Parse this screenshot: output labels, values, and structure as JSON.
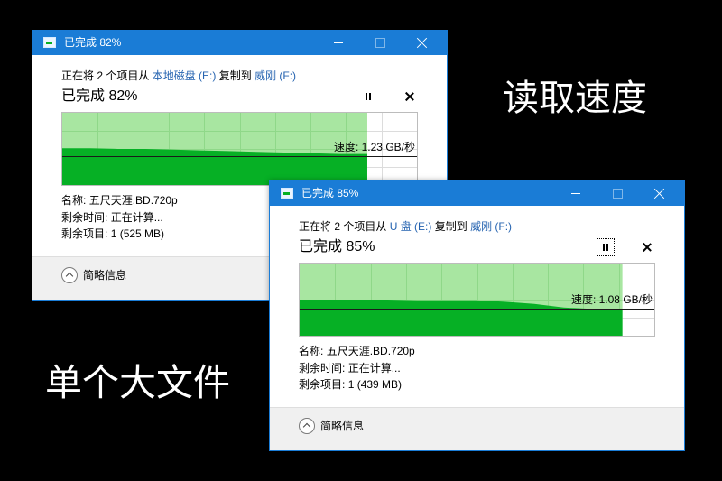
{
  "captions": {
    "top_right": "读取速度",
    "bottom_left": "单个大文件"
  },
  "colors": {
    "background": "#000000",
    "caption_text": "#ffffff",
    "title_bar": "#1a7cd6",
    "link": "#2563b0",
    "graph_light_green": "#a8e6a1",
    "graph_dark_green": "#06b025"
  },
  "icons": {
    "window": "copy-progress-icon",
    "minimize": "minimize-icon",
    "maximize": "maximize-icon",
    "close": "close-icon",
    "pause": "pause-icon",
    "cancel": "cancel-icon",
    "details_toggle": "chevron-up-circle-icon"
  },
  "dialogs": [
    {
      "title": "已完成 82%",
      "status": {
        "prefix": "正在将 2 个项目从",
        "source": "本地磁盘 (E:)",
        "middle": "复制到",
        "destination": "威刚 (F:)"
      },
      "heading": "已完成 82%",
      "speed": {
        "label": "速度:",
        "value": "1.23 GB/秒"
      },
      "details": {
        "name": {
          "label": "名称:",
          "value": "五尺天涯.BD.720p"
        },
        "time_remaining": {
          "label": "剩余时间:",
          "value": "正在计算..."
        },
        "items_remaining": {
          "label": "剩余项目:",
          "value": "1 (525 MB)"
        }
      },
      "details_toggle": "简略信息",
      "graph": {
        "fill": 0.86,
        "current_speed_level": 0.4,
        "speed_history": [
          0.51,
          0.51,
          0.5,
          0.5,
          0.49,
          0.48,
          0.47,
          0.46,
          0.45,
          0.44,
          0.43,
          0.43
        ]
      }
    },
    {
      "title": "已完成 85%",
      "status": {
        "prefix": "正在将 2 个项目从",
        "source": "U 盘 (E:)",
        "middle": "复制到",
        "destination": "威刚 (F:)"
      },
      "heading": "已完成 85%",
      "speed": {
        "label": "速度:",
        "value": "1.08 GB/秒"
      },
      "details": {
        "name": {
          "label": "名称:",
          "value": "五尺天涯.BD.720p"
        },
        "time_remaining": {
          "label": "剩余时间:",
          "value": "正在计算..."
        },
        "items_remaining": {
          "label": "剩余项目:",
          "value": "1 (439 MB)"
        }
      },
      "details_toggle": "简略信息",
      "graph": {
        "fill": 0.91,
        "current_speed_level": 0.37,
        "speed_history": [
          0.5,
          0.5,
          0.5,
          0.5,
          0.49,
          0.49,
          0.49,
          0.47,
          0.44,
          0.39,
          0.37,
          0.37
        ]
      }
    }
  ]
}
